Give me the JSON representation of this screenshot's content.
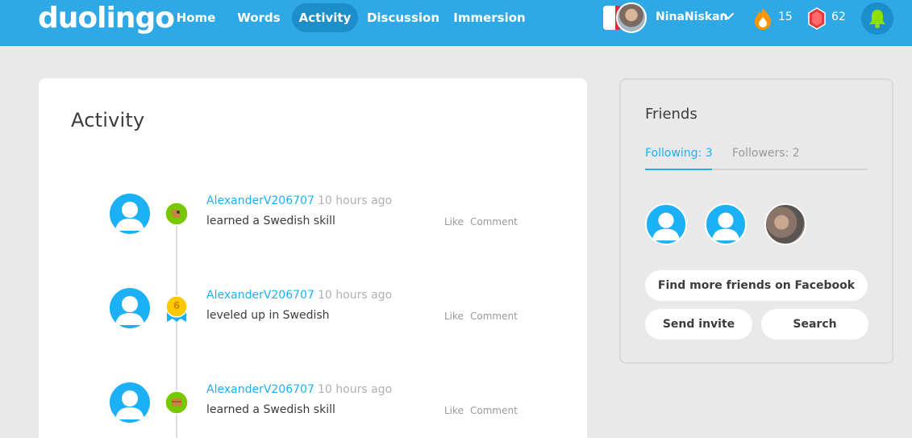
{
  "header": {
    "logo": "duolingo",
    "nav": [
      {
        "label": "Home",
        "active": false
      },
      {
        "label": "Words",
        "active": false
      },
      {
        "label": "Activity",
        "active": true
      },
      {
        "label": "Discussion",
        "active": false
      },
      {
        "label": "Immersion",
        "active": false
      }
    ],
    "username": "NinaNiskan",
    "streak": "15",
    "gems": "62",
    "icons": [
      "french-flag-icon",
      "chevron-down-icon",
      "flame-icon",
      "gem-icon",
      "bell-icon"
    ]
  },
  "activity": {
    "title": "Activity",
    "items": [
      {
        "user": "AlexanderV206707",
        "time": "10 hours ago",
        "text": "learned a Swedish skill",
        "badge": "skill-icon",
        "like": "Like",
        "comment": "Comment"
      },
      {
        "user": "AlexanderV206707",
        "time": "10 hours ago",
        "text": "leveled up in Swedish",
        "badge": "level-badge-icon",
        "level": "6",
        "like": "Like",
        "comment": "Comment"
      },
      {
        "user": "AlexanderV206707",
        "time": "10 hours ago",
        "text": "learned a Swedish skill",
        "badge": "skill-icon",
        "like": "Like",
        "comment": "Comment"
      }
    ]
  },
  "friends": {
    "title": "Friends",
    "tabs": [
      {
        "label": "Following: 3",
        "active": true
      },
      {
        "label": "Followers: 2",
        "active": false
      }
    ],
    "buttons": {
      "facebook": "Find more friends on Facebook",
      "invite": "Send invite",
      "search": "Search"
    }
  },
  "colors": {
    "brand_blue": "#2fa8e6",
    "link_blue": "#1cb0f6",
    "nav_active": "#1c8ec9",
    "background": "#e9e9e9"
  }
}
